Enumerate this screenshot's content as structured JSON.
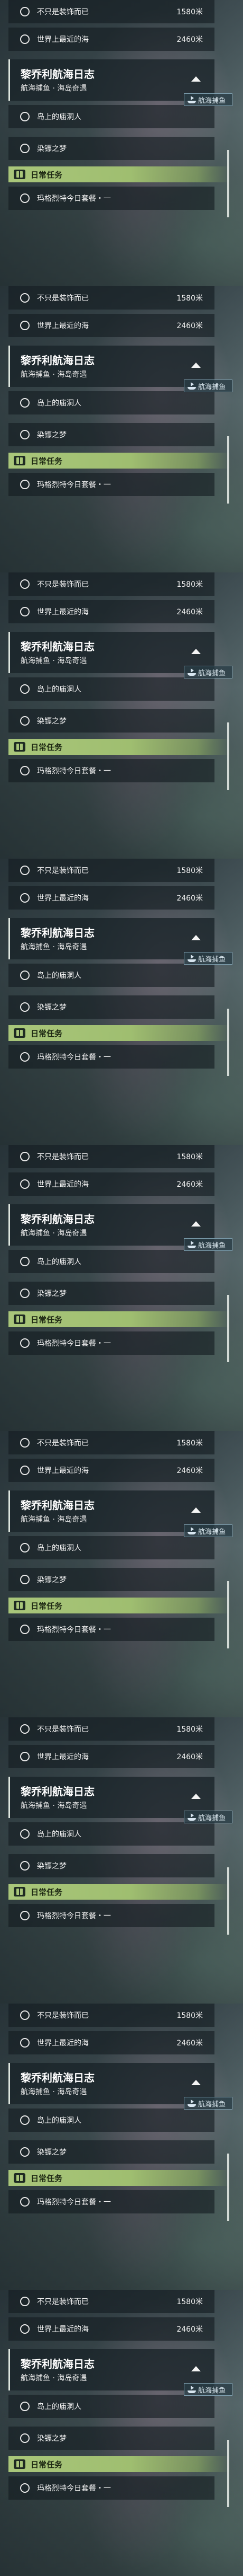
{
  "quest_panel": {
    "stories": [
      {
        "label": "不只是装饰而已",
        "distance": "1580米"
      },
      {
        "label": "世界上最近的海",
        "distance": "2460米"
      }
    ],
    "chapter": {
      "title": "黎乔利航海日志",
      "subtitle": "航海捕鱼 · 海岛奇遇"
    },
    "nav_badge": {
      "label": "航海捕鱼",
      "icon": "ship-icon"
    },
    "chapter_quests": [
      {
        "label": "岛上的庙洞人"
      },
      {
        "label": "染镖之梦"
      }
    ],
    "daily": {
      "title": "日常任务",
      "icon": "calendar-icon",
      "quest": "玛格烈特今日套餐・一"
    },
    "colors": {
      "daily_bar": "#a9c67a",
      "panel_bg": "#141c20"
    }
  },
  "frames": [
    {
      "scrollbar_level": 0.55
    },
    {
      "scrollbar_level": 0.55
    },
    {
      "scrollbar_level": 0.55
    },
    {
      "scrollbar_level": 0.55
    },
    {
      "scrollbar_level": 0.55
    },
    {
      "scrollbar_level": 0.55
    },
    {
      "scrollbar_level": 0.55
    },
    {
      "scrollbar_level": 0.55
    },
    {
      "scrollbar_level": 0.55
    }
  ]
}
